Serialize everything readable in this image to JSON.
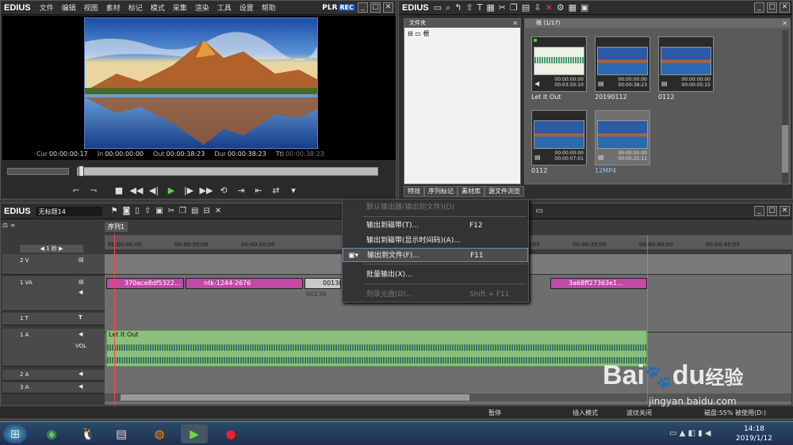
{
  "player": {
    "logo": "EDIUS",
    "menu": [
      "文件",
      "编辑",
      "视图",
      "素材",
      "标记",
      "模式",
      "采集",
      "渲染",
      "工具",
      "设置",
      "帮助"
    ],
    "plr": "PLR",
    "rec": "REC",
    "cur_label": "Cur",
    "cur": "00:00:00:17",
    "in_label": "In",
    "in": "00:00:00:00",
    "out_label": "Out",
    "out": "00:00:38:23",
    "dur_label": "Dur",
    "dur": "00:00:38:23",
    "ttl_label": "Ttl",
    "ttl": "00:00:38:23"
  },
  "bin": {
    "logo": "EDIUS",
    "tree_title": "文件夹",
    "tree_root": "根",
    "content_title": "根 (1/17)",
    "clips": [
      {
        "name": "Let It Out",
        "tc1": "00:00:00:00",
        "tc2": "00:03:50:10",
        "kind": "audio"
      },
      {
        "name": "20190112",
        "tc1": "00:00:00:00",
        "tc2": "00:00:38:23",
        "kind": "video"
      },
      {
        "name": "0112",
        "tc1": "00:00:00:00",
        "tc2": "00:00:05:15",
        "kind": "video"
      },
      {
        "name": "0112",
        "tc1": "00:00:00:00",
        "tc2": "00:00:07:01",
        "kind": "video"
      },
      {
        "name": "12MP4",
        "tc1": "00:00:00:00",
        "tc2": "00:00:25:11",
        "kind": "video"
      }
    ],
    "tabs": [
      "特效",
      "序列标记",
      "素材库",
      "源文件浏览"
    ]
  },
  "timeline": {
    "logo": "EDIUS",
    "project": "无标题14",
    "sequence_tab": "序列1",
    "zoom": "1 秒",
    "ruler": [
      "00:00:00;00",
      "00:00:05;00",
      "00:00:10;00",
      "00:00:30;00",
      "00:00:35;00",
      "00:00:40;00",
      "00:00:45;00"
    ],
    "tracks": {
      "t2v": "2 V",
      "t1va": "1 VA",
      "t1t": "1 T",
      "t1a": "1 A",
      "vol": "VOL",
      "t2a": "2 A",
      "t3a": "3 A"
    },
    "clips": {
      "c1": "370ace8df5322...",
      "c2": "ntk-1244-2676",
      "c3": "00138",
      "c3_sub": "00136",
      "c4": "3a68ff27363e1...",
      "audio": "Let It Out"
    },
    "status": {
      "pause": "暂停",
      "insert": "插入模式",
      "wave_off": "波纹关闭",
      "disk": "磁盘:55% 被使用(D:)"
    }
  },
  "context_menu": {
    "items": [
      {
        "label": "默认输出器(输出到文件)(D)",
        "key": "",
        "state": "disabled"
      },
      {
        "label": "输出到磁带(T)...",
        "key": "F12",
        "state": "normal"
      },
      {
        "label": "输出到磁带(显示时间码)(A)...",
        "key": "",
        "state": "normal"
      },
      {
        "label": "输出到文件(F)...",
        "key": "F11",
        "state": "hover"
      },
      {
        "label": "批量输出(X)...",
        "key": "",
        "state": "normal"
      },
      {
        "label": "刻录光盘(D)...",
        "key": "Shift + F11",
        "state": "disabled"
      }
    ]
  },
  "taskbar": {
    "time": "14:18",
    "date": "2019/1/12"
  },
  "watermark": {
    "brand": "Bai",
    "brand2": "du",
    "cn": "经验",
    "url": "jingyan.baidu.com"
  },
  "colors": {
    "accent": "#1e4fa0",
    "clip_video": "#c04aa6",
    "clip_audio": "#8bc07a",
    "playhead": "#ff4040"
  }
}
